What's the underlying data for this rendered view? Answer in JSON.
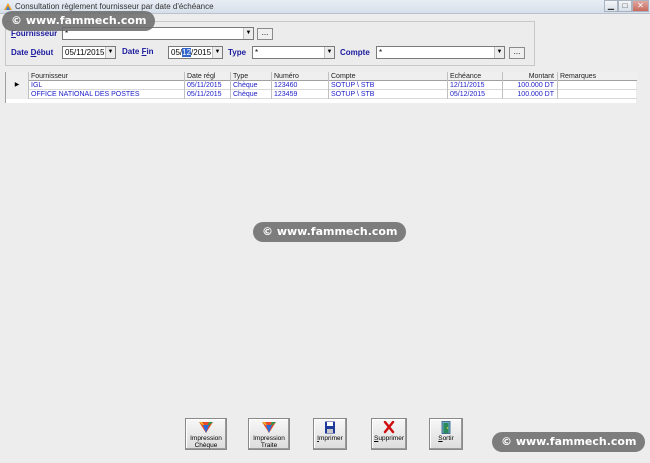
{
  "window": {
    "title": "Consultation règlement fournisseur par date d'échéance"
  },
  "watermark": "© www.fammech.com",
  "filters": {
    "fournisseur_label_u": "F",
    "fournisseur_label_rest": "ournisseur",
    "fournisseur_value": "*",
    "date_debut_label_a": "Date ",
    "date_debut_label_u": "D",
    "date_debut_label_b": "ébut",
    "date_debut_value": "05/11/2015",
    "date_fin_label_a": "Date ",
    "date_fin_label_u": "F",
    "date_fin_label_b": "in",
    "date_fin_day": "05",
    "date_fin_month": "12",
    "date_fin_year": "2015",
    "type_label": "Type",
    "type_value": "*",
    "compte_label": "Compte",
    "compte_value": "*",
    "dots": "..."
  },
  "grid": {
    "columns": [
      "Fournisseur",
      "Date régl",
      "Type",
      "Numéro",
      "Compte",
      "Echéance",
      "Montant",
      "Remarques"
    ],
    "row_indicator": "▶",
    "rows": [
      {
        "fournisseur": "IGL",
        "date_regl": "05/11/2015",
        "type": "Chèque",
        "numero": "123460",
        "compte": "SOTUP  \\ STB",
        "echeance": "12/11/2015",
        "montant": "100.000 DT",
        "remarques": ""
      },
      {
        "fournisseur": "OFFICE NATIONAL DES POSTES",
        "date_regl": "05/11/2015",
        "type": "Chèque",
        "numero": "123459",
        "compte": "SOTUP  \\ STB",
        "echeance": "05/12/2015",
        "montant": "100.000 DT",
        "remarques": ""
      }
    ]
  },
  "buttons": {
    "cheque_line1": "Impression",
    "cheque_line2": "Chèque",
    "traite_line1": "Impression",
    "traite_line2": "Traite",
    "print_u": "I",
    "print_rest": "mprimer",
    "delete_u": "S",
    "delete_rest": "upprimer",
    "exit_u": "S",
    "exit_rest": "ortir"
  },
  "icons": {
    "app": "app-icon",
    "cheque": "impression-cheque-icon",
    "traite": "impression-traite-icon",
    "print": "floppy-disk-icon",
    "delete": "red-x-icon",
    "exit": "door-exit-icon"
  },
  "colors": {
    "label_blue": "#1a1a9e",
    "row_blue": "#2020c8",
    "selection": "#3366cc",
    "delete_red": "#d01010"
  }
}
